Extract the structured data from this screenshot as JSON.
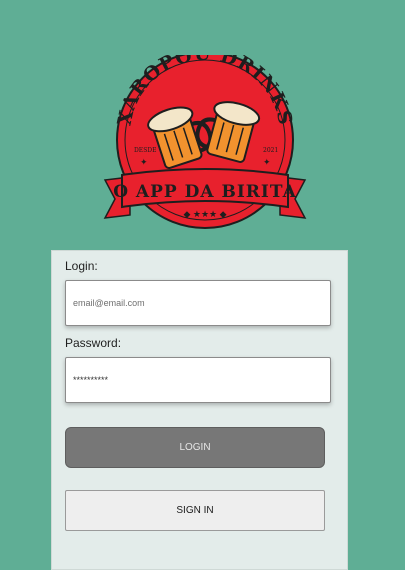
{
  "logo": {
    "title": "XAROPOU DRINKS",
    "since_left": "DESDE",
    "since_right": "2021",
    "tagline": "O APP DA BIRITA",
    "colors": {
      "red": "#e8212d",
      "dark": "#1e1e1e",
      "beer": "#f2922e",
      "foam": "#f3e6c9"
    }
  },
  "form": {
    "login_label": "Login:",
    "email_placeholder": "email@email.com",
    "password_label": "Password:",
    "password_value": "**********",
    "login_button": "LOGIN",
    "signin_button": "SIGN IN"
  }
}
